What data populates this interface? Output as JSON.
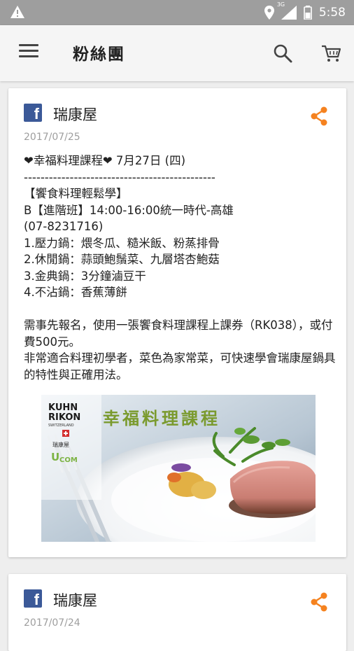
{
  "status_bar": {
    "network": "3G",
    "time": "5:58"
  },
  "app_bar": {
    "title": "粉絲團"
  },
  "posts": [
    {
      "author": "瑞康屋",
      "date": "2017/07/25",
      "body": "❤幸福料理課程❤ 7月27日 (四)\n----------------------------------------------\n【饗食料理輕鬆學】\nB【進階班】14:00-16:00統一時代-高雄\n(07-8231716)\n1.壓力鍋：煨冬瓜、糙米飯、粉蒸排骨\n2.休閒鍋：蒜頭鮑鬚菜、九層塔杏鮑菇\n3.金典鍋：3分鐘滷豆干\n4.不沾鍋：香蕉薄餅\n\n需事先報名，使用一張饗食料理課程上課券（RK038），或付費500元。\n非常適合料理初學者，菜色為家常菜，可快速學會瑞康屋鍋具的特性與正確用法。",
      "image": {
        "brand_line1": "KUHN",
        "brand_line2": "RIKON",
        "brand_line3": "SWITZERLAND",
        "brand_cn": "瑞康屋",
        "ucom": "COM",
        "headline": "幸福料理課程"
      }
    },
    {
      "author": "瑞康屋",
      "date": "2017/07/24"
    }
  ],
  "colors": {
    "status_bar": "#9e9e9e",
    "app_bar": "#f5f5f5",
    "facebook": "#3b5998",
    "share": "#f5821f",
    "headline": "#7a9a2e"
  }
}
